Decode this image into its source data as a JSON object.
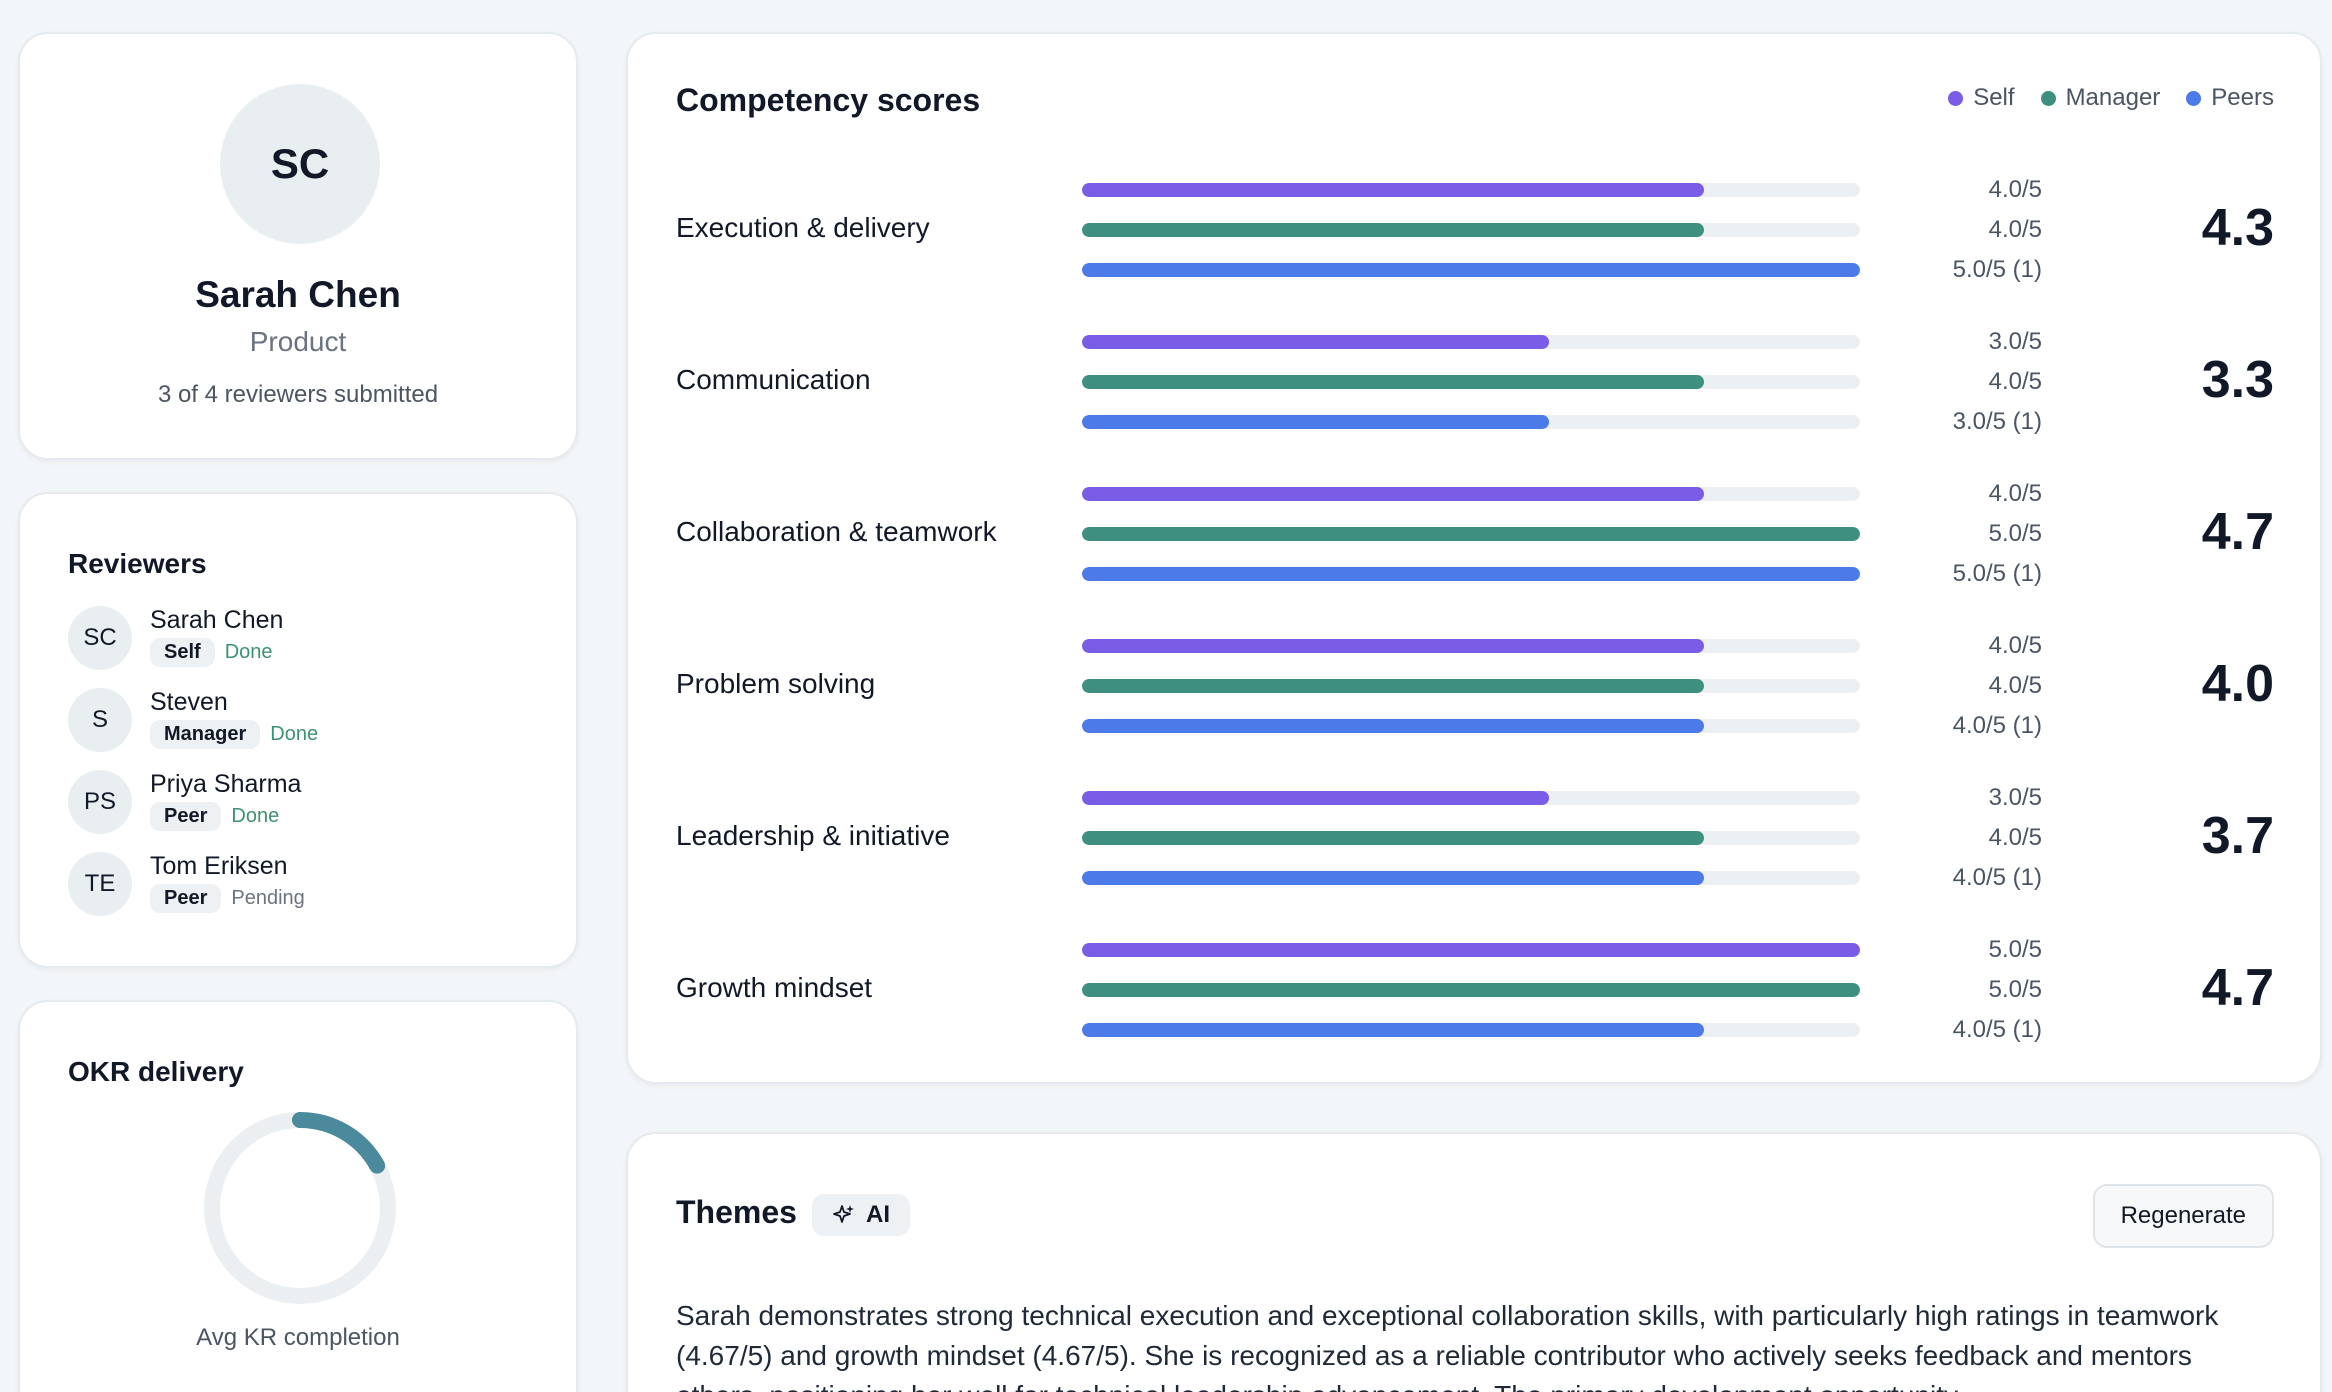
{
  "profile": {
    "initials": "SC",
    "name": "Sarah Chen",
    "department": "Product",
    "submitted": "3 of 4 reviewers submitted"
  },
  "reviewers": {
    "title": "Reviewers",
    "items": [
      {
        "initials": "SC",
        "name": "Sarah Chen",
        "role": "Self",
        "status": "Done"
      },
      {
        "initials": "S",
        "name": "Steven",
        "role": "Manager",
        "status": "Done"
      },
      {
        "initials": "PS",
        "name": "Priya Sharma",
        "role": "Peer",
        "status": "Done"
      },
      {
        "initials": "TE",
        "name": "Tom Eriksen",
        "role": "Peer",
        "status": "Pending"
      }
    ]
  },
  "okr": {
    "title": "OKR delivery",
    "label": "Avg KR completion",
    "completion": 0.17,
    "ring_color": "#4a8a9c",
    "track_color": "#ebeff2"
  },
  "competency": {
    "title": "Competency scores",
    "legend": [
      {
        "name": "Self",
        "color": "#7b5ce6"
      },
      {
        "name": "Manager",
        "color": "#3f8f80"
      },
      {
        "name": "Peers",
        "color": "#4a7be8"
      }
    ],
    "max": 5,
    "rows": [
      {
        "name": "Execution & delivery",
        "average": "4.3",
        "bars": [
          {
            "value": 4.0,
            "label": "4.0/5"
          },
          {
            "value": 4.0,
            "label": "4.0/5"
          },
          {
            "value": 5.0,
            "label": "5.0/5 (1)"
          }
        ]
      },
      {
        "name": "Communication",
        "average": "3.3",
        "bars": [
          {
            "value": 3.0,
            "label": "3.0/5"
          },
          {
            "value": 4.0,
            "label": "4.0/5"
          },
          {
            "value": 3.0,
            "label": "3.0/5 (1)"
          }
        ]
      },
      {
        "name": "Collaboration & teamwork",
        "average": "4.7",
        "bars": [
          {
            "value": 4.0,
            "label": "4.0/5"
          },
          {
            "value": 5.0,
            "label": "5.0/5"
          },
          {
            "value": 5.0,
            "label": "5.0/5 (1)"
          }
        ]
      },
      {
        "name": "Problem solving",
        "average": "4.0",
        "bars": [
          {
            "value": 4.0,
            "label": "4.0/5"
          },
          {
            "value": 4.0,
            "label": "4.0/5"
          },
          {
            "value": 4.0,
            "label": "4.0/5 (1)"
          }
        ]
      },
      {
        "name": "Leadership & initiative",
        "average": "3.7",
        "bars": [
          {
            "value": 3.0,
            "label": "3.0/5"
          },
          {
            "value": 4.0,
            "label": "4.0/5"
          },
          {
            "value": 4.0,
            "label": "4.0/5 (1)"
          }
        ]
      },
      {
        "name": "Growth mindset",
        "average": "4.7",
        "bars": [
          {
            "value": 5.0,
            "label": "5.0/5"
          },
          {
            "value": 5.0,
            "label": "5.0/5"
          },
          {
            "value": 4.0,
            "label": "4.0/5 (1)"
          }
        ]
      }
    ]
  },
  "themes": {
    "title": "Themes",
    "ai_label": "AI",
    "regenerate_label": "Regenerate",
    "text": "Sarah demonstrates strong technical execution and exceptional collaboration skills, with particularly high ratings in teamwork (4.67/5) and growth mindset (4.67/5). She is recognized as a reliable contributor who actively seeks feedback and mentors others, positioning her well for technical leadership advancement. The primary development opportunity"
  }
}
